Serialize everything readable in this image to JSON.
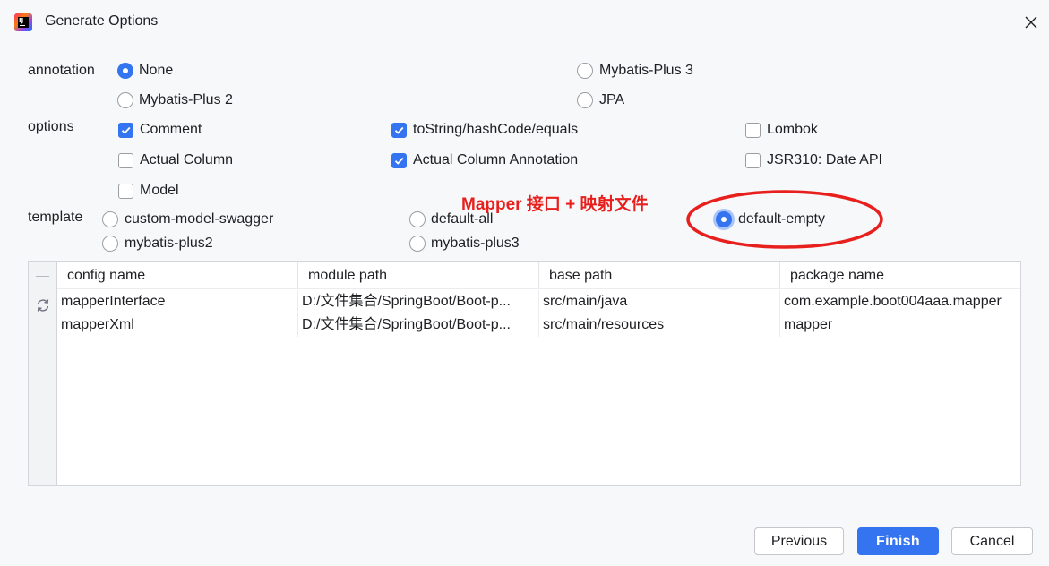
{
  "window": {
    "title": "Generate Options",
    "app_icon_letters": "IJ"
  },
  "annotation": {
    "label": "annotation",
    "options": [
      "None",
      "Mybatis-Plus 3",
      "Mybatis-Plus 2",
      "JPA"
    ],
    "selected": "None"
  },
  "options": {
    "label": "options",
    "items": [
      {
        "label": "Comment",
        "checked": true
      },
      {
        "label": "toString/hashCode/equals",
        "checked": true
      },
      {
        "label": "Lombok",
        "checked": false
      },
      {
        "label": "Actual Column",
        "checked": false
      },
      {
        "label": "Actual Column Annotation",
        "checked": true
      },
      {
        "label": "JSR310: Date API",
        "checked": false
      },
      {
        "label": "Model",
        "checked": false
      }
    ]
  },
  "template": {
    "label": "template",
    "options": [
      "custom-model-swagger",
      "default-all",
      "default-empty",
      "mybatis-plus2",
      "mybatis-plus3"
    ],
    "selected": "default-empty"
  },
  "callout": {
    "text": "Mapper 接口 + 映射文件",
    "color": "#e8201d"
  },
  "table": {
    "columns": [
      "config name",
      "module path",
      "base path",
      "package name"
    ],
    "rows": [
      [
        "mapperInterface",
        "D:/文件集合/SpringBoot/Boot-p...",
        "src/main/java",
        "com.example.boot004aaa.mapper"
      ],
      [
        "mapperXml",
        "D:/文件集合/SpringBoot/Boot-p...",
        "src/main/resources",
        "mapper"
      ]
    ]
  },
  "buttons": {
    "previous": "Previous",
    "finish": "Finish",
    "cancel": "Cancel"
  },
  "colors": {
    "accent": "#3574f0",
    "background": "#f7f8fa"
  }
}
